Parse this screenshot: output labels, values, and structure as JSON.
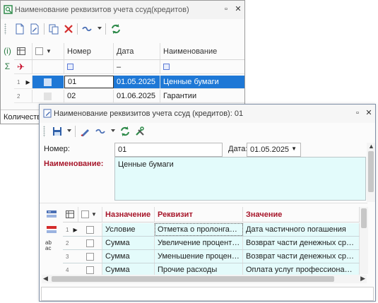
{
  "back_window": {
    "title": "Наименование реквизитов учета ссуд(кредитов)",
    "columns": [
      "Номер",
      "Дата",
      "Наименование"
    ],
    "filter_date": "–",
    "rows": [
      {
        "num": "1",
        "number": "01",
        "date": "01.05.2025",
        "name": "Ценные бумаги"
      },
      {
        "num": "2",
        "number": "02",
        "date": "01.06.2025",
        "name": "Гарантии"
      }
    ],
    "status_text": "Количеств",
    "side_label": "(i)",
    "sum_label": "Σ"
  },
  "front_window": {
    "title": "Наименование реквизитов учета ссуд (кредитов): 01",
    "number_label": "Номер:",
    "number_value": "01",
    "date_label": "Дата:",
    "date_value": "01.05.2025",
    "name_label": "Наименование:",
    "name_value": "Ценные бумаги",
    "columns": [
      "Назначение",
      "Реквизит",
      "Значение"
    ],
    "rows": [
      {
        "num": "1",
        "purpose": "Условие",
        "attr": "Отметка о пролонга…",
        "value": "Дата частичного погашения"
      },
      {
        "num": "2",
        "purpose": "Сумма",
        "attr": "Увеличение процент…",
        "value": "Возврат части денежных ср…"
      },
      {
        "num": "3",
        "purpose": "Сумма",
        "attr": "Уменьшение процен…",
        "value": "Возврат части денежных ср…"
      },
      {
        "num": "4",
        "purpose": "Сумма",
        "attr": "Прочие расходы",
        "value": "Оплата услуг профессиона…"
      }
    ]
  },
  "colors": {
    "accent_blue": "#1e78d6",
    "label_red": "#a7162a",
    "cyan_fill": "#e4fbfb"
  }
}
